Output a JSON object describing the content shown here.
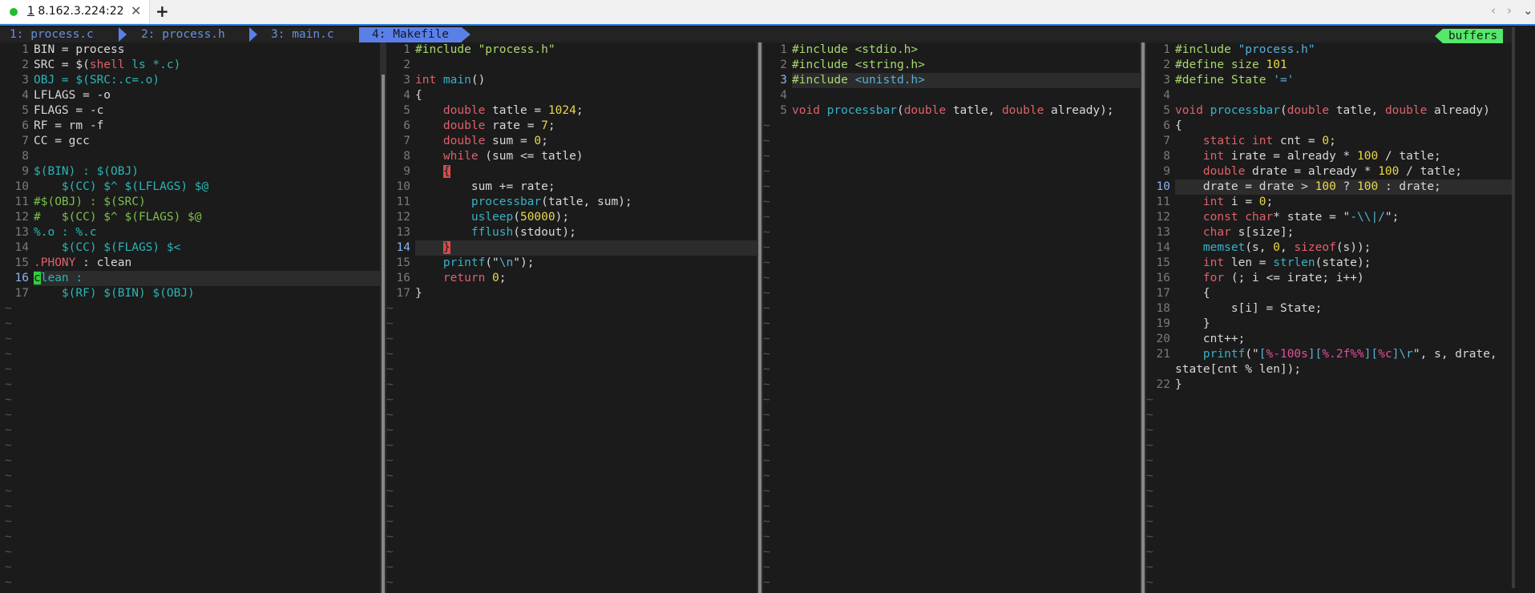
{
  "window": {
    "tab_number": "1",
    "tab_title": "8.162.3.224:22",
    "close_glyph": "✕",
    "new_tab_glyph": "+",
    "nav_prev": "‹",
    "nav_next": "›",
    "nav_menu": "⌄"
  },
  "tabline": {
    "buffers": [
      {
        "label": "1: process.c"
      },
      {
        "label": "2: process.h"
      },
      {
        "label": "3: main.c"
      },
      {
        "label": "4: Makefile"
      }
    ],
    "right_label": "buffers"
  },
  "panes": {
    "makefile": [
      {
        "n": "1",
        "segs": [
          [
            "BIN = process",
            "t-var"
          ]
        ]
      },
      {
        "n": "2",
        "segs": [
          [
            "SRC = $(",
            "t-var"
          ],
          [
            "shell",
            "t-kw"
          ],
          [
            " ls *.c)",
            "t-cy"
          ]
        ]
      },
      {
        "n": "3",
        "segs": [
          [
            "OBJ = $(SRC:.c=.o)",
            "t-cy"
          ]
        ]
      },
      {
        "n": "4",
        "segs": [
          [
            "LFLAGS = -o",
            "t-var"
          ]
        ]
      },
      {
        "n": "5",
        "segs": [
          [
            "FLAGS = -c",
            "t-var"
          ]
        ]
      },
      {
        "n": "6",
        "segs": [
          [
            "RF = rm -f",
            "t-var"
          ]
        ]
      },
      {
        "n": "7",
        "segs": [
          [
            "CC = gcc",
            "t-var"
          ]
        ]
      },
      {
        "n": "8",
        "segs": []
      },
      {
        "n": "9",
        "segs": [
          [
            "$(BIN) : $(OBJ)",
            "t-cy"
          ]
        ]
      },
      {
        "n": "10",
        "segs": [
          [
            "    $(CC) $^ $(LFLAGS) $@",
            "t-cy"
          ]
        ]
      },
      {
        "n": "11",
        "segs": [
          [
            "#$(OBJ) : $(SRC)",
            "t-gr"
          ]
        ]
      },
      {
        "n": "12",
        "segs": [
          [
            "#   $(CC) $^ $(FLAGS) $@",
            "t-gr"
          ]
        ]
      },
      {
        "n": "13",
        "segs": [
          [
            "%.o : %.c",
            "t-cy"
          ]
        ]
      },
      {
        "n": "14",
        "segs": [
          [
            "    $(CC) $(FLAGS) $<",
            "t-cy"
          ]
        ]
      },
      {
        "n": "15",
        "segs": [
          [
            ".PHONY",
            "t-kw"
          ],
          [
            " : clean",
            "t-var"
          ]
        ]
      },
      {
        "n": "16",
        "cur": true,
        "segs": [
          [
            "c",
            "cursor"
          ],
          [
            "lean :",
            "t-cy"
          ]
        ]
      },
      {
        "n": "17",
        "segs": [
          [
            "    $(RF) $(BIN) $(OBJ)",
            "t-cy"
          ]
        ]
      }
    ],
    "main_c": [
      {
        "n": "1",
        "segs": [
          [
            "#include \"process.h\"",
            "t-pre"
          ]
        ]
      },
      {
        "n": "2",
        "segs": []
      },
      {
        "n": "3",
        "segs": [
          [
            "int ",
            "t-kw"
          ],
          [
            "main",
            "t-fn"
          ],
          [
            "()",
            "t-var"
          ]
        ]
      },
      {
        "n": "4",
        "segs": [
          [
            "{",
            "t-var"
          ]
        ]
      },
      {
        "n": "5",
        "segs": [
          [
            "    ",
            "t-var"
          ],
          [
            "double",
            "t-kw"
          ],
          [
            " tatle = ",
            "t-var"
          ],
          [
            "1024",
            "t-num"
          ],
          [
            ";",
            "t-var"
          ]
        ]
      },
      {
        "n": "6",
        "segs": [
          [
            "    ",
            "t-var"
          ],
          [
            "double",
            "t-kw"
          ],
          [
            " rate = ",
            "t-var"
          ],
          [
            "7",
            "t-num"
          ],
          [
            ";",
            "t-var"
          ]
        ]
      },
      {
        "n": "7",
        "segs": [
          [
            "    ",
            "t-var"
          ],
          [
            "double",
            "t-kw"
          ],
          [
            " sum = ",
            "t-var"
          ],
          [
            "0",
            "t-num"
          ],
          [
            ";",
            "t-var"
          ]
        ]
      },
      {
        "n": "8",
        "segs": [
          [
            "    ",
            "t-var"
          ],
          [
            "while",
            "t-kw"
          ],
          [
            " (sum <= tatle)",
            "t-var"
          ]
        ]
      },
      {
        "n": "9",
        "segs": [
          [
            "    ",
            "t-var"
          ],
          [
            "{",
            "brace"
          ]
        ]
      },
      {
        "n": "10",
        "segs": [
          [
            "        sum += rate;",
            "t-var"
          ]
        ]
      },
      {
        "n": "11",
        "segs": [
          [
            "        ",
            "t-var"
          ],
          [
            "processbar",
            "t-fn"
          ],
          [
            "(tatle, sum);",
            "t-var"
          ]
        ]
      },
      {
        "n": "12",
        "segs": [
          [
            "        ",
            "t-var"
          ],
          [
            "usleep",
            "t-fn"
          ],
          [
            "(",
            "t-var"
          ],
          [
            "50000",
            "t-num"
          ],
          [
            ");",
            "t-var"
          ]
        ]
      },
      {
        "n": "13",
        "segs": [
          [
            "        ",
            "t-var"
          ],
          [
            "fflush",
            "t-fn"
          ],
          [
            "(stdout);",
            "t-var"
          ]
        ]
      },
      {
        "n": "14",
        "cur": true,
        "segs": [
          [
            "    ",
            "t-var"
          ],
          [
            "}",
            "brace"
          ]
        ]
      },
      {
        "n": "15",
        "segs": [
          [
            "    ",
            "t-var"
          ],
          [
            "printf",
            "t-fn"
          ],
          [
            "(\"",
            "t-var"
          ],
          [
            "\\n",
            "t-str"
          ],
          [
            "\");",
            "t-var"
          ]
        ]
      },
      {
        "n": "16",
        "segs": [
          [
            "    ",
            "t-var"
          ],
          [
            "return",
            "t-kw"
          ],
          [
            " ",
            "t-var"
          ],
          [
            "0",
            "t-num"
          ],
          [
            ";",
            "t-var"
          ]
        ]
      },
      {
        "n": "17",
        "segs": [
          [
            "}",
            "t-var"
          ]
        ]
      }
    ],
    "process_h": [
      {
        "n": "1",
        "segs": [
          [
            "#include <stdio.h>",
            "t-pre"
          ]
        ]
      },
      {
        "n": "2",
        "segs": [
          [
            "#include <string.h>",
            "t-pre"
          ]
        ]
      },
      {
        "n": "3",
        "cur": true,
        "segs": [
          [
            "#include ",
            "t-pre"
          ],
          [
            "<unistd.h>",
            "t-str"
          ]
        ]
      },
      {
        "n": "4",
        "segs": []
      },
      {
        "n": "5",
        "segs": [
          [
            "void",
            "t-kw"
          ],
          [
            " ",
            "t-var"
          ],
          [
            "processbar",
            "t-fn"
          ],
          [
            "(",
            "t-var"
          ],
          [
            "double",
            "t-kw"
          ],
          [
            " tatle, ",
            "t-var"
          ],
          [
            "double",
            "t-kw"
          ],
          [
            " already);",
            "t-var"
          ]
        ]
      }
    ],
    "process_c": [
      {
        "n": "1",
        "segs": [
          [
            "#include ",
            "t-pre"
          ],
          [
            "\"process.h\"",
            "t-str"
          ]
        ]
      },
      {
        "n": "2",
        "segs": [
          [
            "#define size ",
            "t-pre"
          ],
          [
            "101",
            "t-num"
          ]
        ]
      },
      {
        "n": "3",
        "segs": [
          [
            "#define State ",
            "t-pre"
          ],
          [
            "'='",
            "t-str"
          ]
        ]
      },
      {
        "n": "4",
        "segs": []
      },
      {
        "n": "5",
        "segs": [
          [
            "void",
            "t-kw"
          ],
          [
            " ",
            "t-var"
          ],
          [
            "processbar",
            "t-fn"
          ],
          [
            "(",
            "t-var"
          ],
          [
            "double",
            "t-kw"
          ],
          [
            " tatle, ",
            "t-var"
          ],
          [
            "double",
            "t-kw"
          ],
          [
            " already)",
            "t-var"
          ]
        ]
      },
      {
        "n": "6",
        "segs": [
          [
            "{",
            "t-var"
          ]
        ]
      },
      {
        "n": "7",
        "segs": [
          [
            "    ",
            "t-var"
          ],
          [
            "static int",
            "t-kw"
          ],
          [
            " cnt = ",
            "t-var"
          ],
          [
            "0",
            "t-num"
          ],
          [
            ";",
            "t-var"
          ]
        ]
      },
      {
        "n": "8",
        "segs": [
          [
            "    ",
            "t-var"
          ],
          [
            "int",
            "t-kw"
          ],
          [
            " irate = already * ",
            "t-var"
          ],
          [
            "100",
            "t-num"
          ],
          [
            " / tatle;",
            "t-var"
          ]
        ]
      },
      {
        "n": "9",
        "segs": [
          [
            "    ",
            "t-var"
          ],
          [
            "double",
            "t-kw"
          ],
          [
            " drate = already * ",
            "t-var"
          ],
          [
            "100",
            "t-num"
          ],
          [
            " / tatle;",
            "t-var"
          ]
        ]
      },
      {
        "n": "10",
        "cur": true,
        "segs": [
          [
            "    drate = drate > ",
            "t-var"
          ],
          [
            "100",
            "t-num"
          ],
          [
            " ? ",
            "t-var"
          ],
          [
            "100",
            "t-num"
          ],
          [
            " : drate;",
            "t-var"
          ]
        ]
      },
      {
        "n": "11",
        "segs": [
          [
            "    ",
            "t-var"
          ],
          [
            "int",
            "t-kw"
          ],
          [
            " i = ",
            "t-var"
          ],
          [
            "0",
            "t-num"
          ],
          [
            ";",
            "t-var"
          ]
        ]
      },
      {
        "n": "12",
        "segs": [
          [
            "    ",
            "t-var"
          ],
          [
            "const char",
            "t-kw"
          ],
          [
            "* state = \"",
            "t-var"
          ],
          [
            "-\\\\|/",
            "t-str"
          ],
          [
            "\";",
            "t-var"
          ]
        ]
      },
      {
        "n": "13",
        "segs": [
          [
            "    ",
            "t-var"
          ],
          [
            "char",
            "t-kw"
          ],
          [
            " s[size];",
            "t-var"
          ]
        ]
      },
      {
        "n": "14",
        "segs": [
          [
            "    ",
            "t-var"
          ],
          [
            "memset",
            "t-fn"
          ],
          [
            "(s, ",
            "t-var"
          ],
          [
            "0",
            "t-num"
          ],
          [
            ", ",
            "t-var"
          ],
          [
            "sizeof",
            "t-kw"
          ],
          [
            "(s));",
            "t-var"
          ]
        ]
      },
      {
        "n": "15",
        "segs": [
          [
            "    ",
            "t-var"
          ],
          [
            "int",
            "t-kw"
          ],
          [
            " len = ",
            "t-var"
          ],
          [
            "strlen",
            "t-fn"
          ],
          [
            "(state);",
            "t-var"
          ]
        ]
      },
      {
        "n": "16",
        "segs": [
          [
            "    ",
            "t-var"
          ],
          [
            "for",
            "t-kw"
          ],
          [
            " (; i <= irate; i++)",
            "t-var"
          ]
        ]
      },
      {
        "n": "17",
        "segs": [
          [
            "    {",
            "t-var"
          ]
        ]
      },
      {
        "n": "18",
        "segs": [
          [
            "        s[i] = State;",
            "t-var"
          ]
        ]
      },
      {
        "n": "19",
        "segs": [
          [
            "    }",
            "t-var"
          ]
        ]
      },
      {
        "n": "20",
        "segs": [
          [
            "    cnt++;",
            "t-var"
          ]
        ]
      },
      {
        "n": "21",
        "segs": [
          [
            "    ",
            "t-var"
          ],
          [
            "printf",
            "t-fn"
          ],
          [
            "(\"",
            "t-var"
          ],
          [
            "[",
            "t-str"
          ],
          [
            "%-100s",
            "t-mac"
          ],
          [
            "][",
            "t-str"
          ],
          [
            "%.2f%%",
            "t-mac"
          ],
          [
            "][",
            "t-str"
          ],
          [
            "%c",
            "t-mac"
          ],
          [
            "]\\r",
            "t-str"
          ],
          [
            "\", s, drate,",
            "t-var"
          ]
        ]
      },
      {
        "n": "",
        "segs": [
          [
            "state[cnt % len]);",
            "t-var"
          ]
        ]
      },
      {
        "n": "22",
        "segs": [
          [
            "}",
            "t-var"
          ]
        ]
      }
    ]
  },
  "tilde": "~",
  "colors": {
    "background": "#1b1b1b",
    "accent": "#2a7de1",
    "active_buffer": "#5a80e8",
    "buffers_badge": "#55e86a",
    "connection_dot": "#22bb33"
  }
}
